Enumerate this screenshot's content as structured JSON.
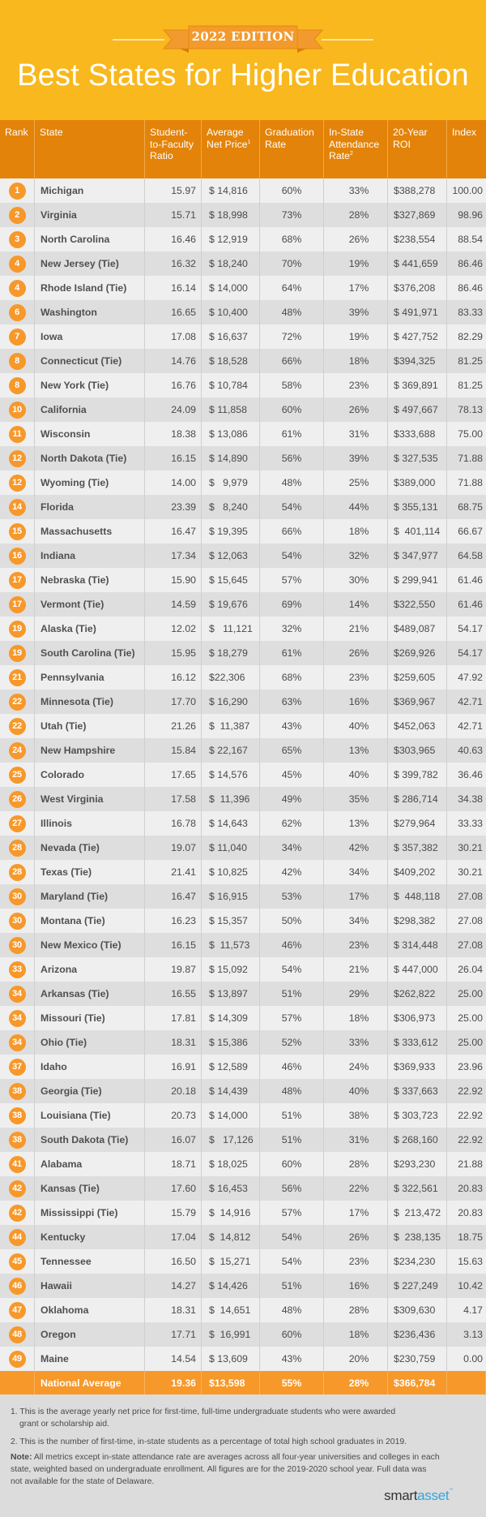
{
  "header": {
    "edition": "2022 EDITION",
    "title": "Best States for Higher Education"
  },
  "colors": {
    "hero_bg": "#f8b81e",
    "header_bg": "#e38309",
    "rank_badge": "#f7982a",
    "avg_row": "#f7982a",
    "row_odd": "#efefef",
    "row_even": "#dedede",
    "brand_blue": "#33a6d9"
  },
  "table": {
    "columns": {
      "rank": "Rank",
      "state": "State",
      "sfr_1": "Student-",
      "sfr_2": "to-Faculty",
      "sfr_3": "Ratio",
      "price_1": "Average",
      "price_2": "Net Price",
      "price_sup": "1",
      "grad_1": "Graduation",
      "grad_2": "Rate",
      "att_1": "In-State",
      "att_2": "Attendance",
      "att_3": "Rate",
      "att_sup": "2",
      "roi_1": "20-Year",
      "roi_2": "ROI",
      "index": "Index"
    },
    "national_average": {
      "label": "National Average",
      "student_faculty_ratio": "19.36",
      "net_price": "$13,598",
      "graduation_rate": "55%",
      "attendance_rate": "28%",
      "roi": "$366,784",
      "index": ""
    }
  },
  "chart_data": {
    "type": "table",
    "title": "Best States for Higher Education",
    "subtitle": "2022 EDITION",
    "headers": [
      "Rank",
      "State",
      "Student-to-Faculty Ratio",
      "Average Net Price¹",
      "Graduation Rate",
      "In-State Attendance Rate²",
      "20-Year ROI",
      "Index"
    ],
    "rows": [
      {
        "rank": "1",
        "state": "Michigan",
        "sfr": "15.97",
        "price": "$ 14,816",
        "grad": "60%",
        "att": "33%",
        "roi": "$388,278",
        "index": "100.00"
      },
      {
        "rank": "2",
        "state": "Virginia",
        "sfr": "15.71",
        "price": "$ 18,998",
        "grad": "73%",
        "att": "28%",
        "roi": "$327,869",
        "index": "98.96"
      },
      {
        "rank": "3",
        "state": "North Carolina",
        "sfr": "16.46",
        "price": "$ 12,919",
        "grad": "68%",
        "att": "26%",
        "roi": "$238,554",
        "index": "88.54"
      },
      {
        "rank": "4",
        "state": "New Jersey (Tie)",
        "sfr": "16.32",
        "price": "$ 18,240",
        "grad": "70%",
        "att": "19%",
        "roi": "$ 441,659",
        "index": "86.46"
      },
      {
        "rank": "4",
        "state": "Rhode Island (Tie)",
        "sfr": "16.14",
        "price": "$ 14,000",
        "grad": "64%",
        "att": "17%",
        "roi": "$376,208",
        "index": "86.46"
      },
      {
        "rank": "6",
        "state": "Washington",
        "sfr": "16.65",
        "price": "$ 10,400",
        "grad": "48%",
        "att": "39%",
        "roi": "$ 491,971",
        "index": "83.33"
      },
      {
        "rank": "7",
        "state": "Iowa",
        "sfr": "17.08",
        "price": "$ 16,637",
        "grad": "72%",
        "att": "19%",
        "roi": "$ 427,752",
        "index": "82.29"
      },
      {
        "rank": "8",
        "state": "Connecticut (Tie)",
        "sfr": "14.76",
        "price": "$ 18,528",
        "grad": "66%",
        "att": "18%",
        "roi": "$394,325",
        "index": "81.25"
      },
      {
        "rank": "8",
        "state": "New York (Tie)",
        "sfr": "16.76",
        "price": "$ 10,784",
        "grad": "58%",
        "att": "23%",
        "roi": "$ 369,891",
        "index": "81.25"
      },
      {
        "rank": "10",
        "state": "California",
        "sfr": "24.09",
        "price": "$ 11,858",
        "grad": "60%",
        "att": "26%",
        "roi": "$ 497,667",
        "index": "78.13"
      },
      {
        "rank": "11",
        "state": "Wisconsin",
        "sfr": "18.38",
        "price": "$ 13,086",
        "grad": "61%",
        "att": "31%",
        "roi": "$333,688",
        "index": "75.00"
      },
      {
        "rank": "12",
        "state": "North Dakota (Tie)",
        "sfr": "16.15",
        "price": "$ 14,890",
        "grad": "56%",
        "att": "39%",
        "roi": "$ 327,535",
        "index": "71.88"
      },
      {
        "rank": "12",
        "state": "Wyoming (Tie)",
        "sfr": "14.00",
        "price": "$   9,979",
        "grad": "48%",
        "att": "25%",
        "roi": "$389,000",
        "index": "71.88"
      },
      {
        "rank": "14",
        "state": "Florida",
        "sfr": "23.39",
        "price": "$   8,240",
        "grad": "54%",
        "att": "44%",
        "roi": "$ 355,131",
        "index": "68.75"
      },
      {
        "rank": "15",
        "state": "Massachusetts",
        "sfr": "16.47",
        "price": "$ 19,395",
        "grad": "66%",
        "att": "18%",
        "roi": "$  401,114",
        "index": "66.67"
      },
      {
        "rank": "16",
        "state": "Indiana",
        "sfr": "17.34",
        "price": "$ 12,063",
        "grad": "54%",
        "att": "32%",
        "roi": "$ 347,977",
        "index": "64.58"
      },
      {
        "rank": "17",
        "state": "Nebraska (Tie)",
        "sfr": "15.90",
        "price": "$ 15,645",
        "grad": "57%",
        "att": "30%",
        "roi": "$ 299,941",
        "index": "61.46"
      },
      {
        "rank": "17",
        "state": "Vermont (Tie)",
        "sfr": "14.59",
        "price": "$ 19,676",
        "grad": "69%",
        "att": "14%",
        "roi": "$322,550",
        "index": "61.46"
      },
      {
        "rank": "19",
        "state": "Alaska (Tie)",
        "sfr": "12.02",
        "price": "$   11,121",
        "grad": "32%",
        "att": "21%",
        "roi": "$489,087",
        "index": "54.17"
      },
      {
        "rank": "19",
        "state": "South Carolina (Tie)",
        "sfr": "15.95",
        "price": "$ 18,279",
        "grad": "61%",
        "att": "26%",
        "roi": "$269,926",
        "index": "54.17"
      },
      {
        "rank": "21",
        "state": "Pennsylvania",
        "sfr": "16.12",
        "price": "$22,306",
        "grad": "68%",
        "att": "23%",
        "roi": "$259,605",
        "index": "47.92"
      },
      {
        "rank": "22",
        "state": "Minnesota (Tie)",
        "sfr": "17.70",
        "price": "$ 16,290",
        "grad": "63%",
        "att": "16%",
        "roi": "$369,967",
        "index": "42.71"
      },
      {
        "rank": "22",
        "state": "Utah (Tie)",
        "sfr": "21.26",
        "price": "$  11,387",
        "grad": "43%",
        "att": "40%",
        "roi": "$452,063",
        "index": "42.71"
      },
      {
        "rank": "24",
        "state": "New Hampshire",
        "sfr": "15.84",
        "price": "$ 22,167",
        "grad": "65%",
        "att": "13%",
        "roi": "$303,965",
        "index": "40.63"
      },
      {
        "rank": "25",
        "state": "Colorado",
        "sfr": "17.65",
        "price": "$ 14,576",
        "grad": "45%",
        "att": "40%",
        "roi": "$ 399,782",
        "index": "36.46"
      },
      {
        "rank": "26",
        "state": "West Virginia",
        "sfr": "17.58",
        "price": "$  11,396",
        "grad": "49%",
        "att": "35%",
        "roi": "$ 286,714",
        "index": "34.38"
      },
      {
        "rank": "27",
        "state": "Illinois",
        "sfr": "16.78",
        "price": "$ 14,643",
        "grad": "62%",
        "att": "13%",
        "roi": "$279,964",
        "index": "33.33"
      },
      {
        "rank": "28",
        "state": "Nevada (Tie)",
        "sfr": "19.07",
        "price": "$ 11,040",
        "grad": "34%",
        "att": "42%",
        "roi": "$ 357,382",
        "index": "30.21"
      },
      {
        "rank": "28",
        "state": "Texas (Tie)",
        "sfr": "21.41",
        "price": "$ 10,825",
        "grad": "42%",
        "att": "34%",
        "roi": "$409,202",
        "index": "30.21"
      },
      {
        "rank": "30",
        "state": "Maryland (Tie)",
        "sfr": "16.47",
        "price": "$ 16,915",
        "grad": "53%",
        "att": "17%",
        "roi": "$  448,118",
        "index": "27.08"
      },
      {
        "rank": "30",
        "state": "Montana (Tie)",
        "sfr": "16.23",
        "price": "$ 15,357",
        "grad": "50%",
        "att": "34%",
        "roi": "$298,382",
        "index": "27.08"
      },
      {
        "rank": "30",
        "state": "New Mexico (Tie)",
        "sfr": "16.15",
        "price": "$  11,573",
        "grad": "46%",
        "att": "23%",
        "roi": "$ 314,448",
        "index": "27.08"
      },
      {
        "rank": "33",
        "state": "Arizona",
        "sfr": "19.87",
        "price": "$ 15,092",
        "grad": "54%",
        "att": "21%",
        "roi": "$ 447,000",
        "index": "26.04"
      },
      {
        "rank": "34",
        "state": "Arkansas (Tie)",
        "sfr": "16.55",
        "price": "$ 13,897",
        "grad": "51%",
        "att": "29%",
        "roi": "$262,822",
        "index": "25.00"
      },
      {
        "rank": "34",
        "state": "Missouri (Tie)",
        "sfr": "17.81",
        "price": "$ 14,309",
        "grad": "57%",
        "att": "18%",
        "roi": "$306,973",
        "index": "25.00"
      },
      {
        "rank": "34",
        "state": "Ohio (Tie)",
        "sfr": "18.31",
        "price": "$ 15,386",
        "grad": "52%",
        "att": "33%",
        "roi": "$ 333,612",
        "index": "25.00"
      },
      {
        "rank": "37",
        "state": "Idaho",
        "sfr": "16.91",
        "price": "$ 12,589",
        "grad": "46%",
        "att": "24%",
        "roi": "$369,933",
        "index": "23.96"
      },
      {
        "rank": "38",
        "state": "Georgia (Tie)",
        "sfr": "20.18",
        "price": "$ 14,439",
        "grad": "48%",
        "att": "40%",
        "roi": "$ 337,663",
        "index": "22.92"
      },
      {
        "rank": "38",
        "state": "Louisiana (Tie)",
        "sfr": "20.73",
        "price": "$ 14,000",
        "grad": "51%",
        "att": "38%",
        "roi": "$ 303,723",
        "index": "22.92"
      },
      {
        "rank": "38",
        "state": "South Dakota (Tie)",
        "sfr": "16.07",
        "price": "$   17,126",
        "grad": "51%",
        "att": "31%",
        "roi": "$ 268,160",
        "index": "22.92"
      },
      {
        "rank": "41",
        "state": "Alabama",
        "sfr": "18.71",
        "price": "$ 18,025",
        "grad": "60%",
        "att": "28%",
        "roi": "$293,230",
        "index": "21.88"
      },
      {
        "rank": "42",
        "state": "Kansas (Tie)",
        "sfr": "17.60",
        "price": "$ 16,453",
        "grad": "56%",
        "att": "22%",
        "roi": "$ 322,561",
        "index": "20.83"
      },
      {
        "rank": "42",
        "state": "Mississippi (Tie)",
        "sfr": "15.79",
        "price": "$  14,916",
        "grad": "57%",
        "att": "17%",
        "roi": "$  213,472",
        "index": "20.83"
      },
      {
        "rank": "44",
        "state": "Kentucky",
        "sfr": "17.04",
        "price": "$  14,812",
        "grad": "54%",
        "att": "26%",
        "roi": "$  238,135",
        "index": "18.75"
      },
      {
        "rank": "45",
        "state": "Tennessee",
        "sfr": "16.50",
        "price": "$  15,271",
        "grad": "54%",
        "att": "23%",
        "roi": "$234,230",
        "index": "15.63"
      },
      {
        "rank": "46",
        "state": "Hawaii",
        "sfr": "14.27",
        "price": "$ 14,426",
        "grad": "51%",
        "att": "16%",
        "roi": "$ 227,249",
        "index": "10.42"
      },
      {
        "rank": "47",
        "state": "Oklahoma",
        "sfr": "18.31",
        "price": "$  14,651",
        "grad": "48%",
        "att": "28%",
        "roi": "$309,630",
        "index": "4.17"
      },
      {
        "rank": "48",
        "state": "Oregon",
        "sfr": "17.71",
        "price": "$  16,991",
        "grad": "60%",
        "att": "18%",
        "roi": "$236,436",
        "index": "3.13"
      },
      {
        "rank": "49",
        "state": "Maine",
        "sfr": "14.54",
        "price": "$ 13,609",
        "grad": "43%",
        "att": "20%",
        "roi": "$230,759",
        "index": "0.00"
      }
    ]
  },
  "footnotes": {
    "fn1_line1": "1. This is the average yearly net price for first-time, full-time undergraduate students who were awarded",
    "fn1_line2": "grant or scholarship aid.",
    "fn2": "2. This is the number of first-time, in-state students as a percentage of total high school graduates in 2019.",
    "note_label": "Note:",
    "note_text": " All metrics except in-state attendance rate are averages across all four-year universities and colleges in each state, weighted based on undergraduate enrollment. All figures are for the 2019-2020 school year. Full data was not available for the state of Delaware."
  },
  "brand": {
    "smart": "smart",
    "asset": "asset",
    "tm": "™"
  }
}
